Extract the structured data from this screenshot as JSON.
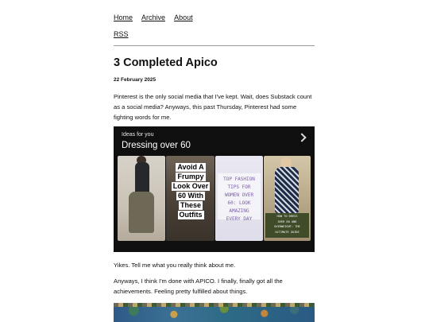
{
  "nav": {
    "home": "Home",
    "archive": "Archive",
    "about": "About",
    "rss": "RSS"
  },
  "post": {
    "title": "3 Completed Apico",
    "date": "22 February 2025",
    "paragraphs": [
      "Pinterest is the only social media that I've kept. Wait, does Substack count as a social media? Anyways, this past Thursday, Pinterest had some fighting words for me.",
      "Yikes. Tell me what you really think about me.",
      "Anyways, I think I'm done with APICO. I finally, finally got all the achievements. Feeling pretty fulfilled about things."
    ]
  },
  "pin_card": {
    "subtitle": "Ideas for you",
    "title": "Dressing over 60",
    "tile2_lines": [
      "Avoid A",
      "Frumpy",
      "Look Over",
      "60 With",
      "These",
      "Outfits"
    ],
    "tile3_text": "TOP FASHION\nTIPS FOR\nWOMEN OVER\n60: LOOK\nAMAZING\nEVERY DAY",
    "tile4_text": "HOW TO DRESS\nOVER 60 AND\nOVERWEIGHT: THE\nULTIMATE GUIDE"
  },
  "icons": {
    "chevron": "chevron-right-icon"
  }
}
